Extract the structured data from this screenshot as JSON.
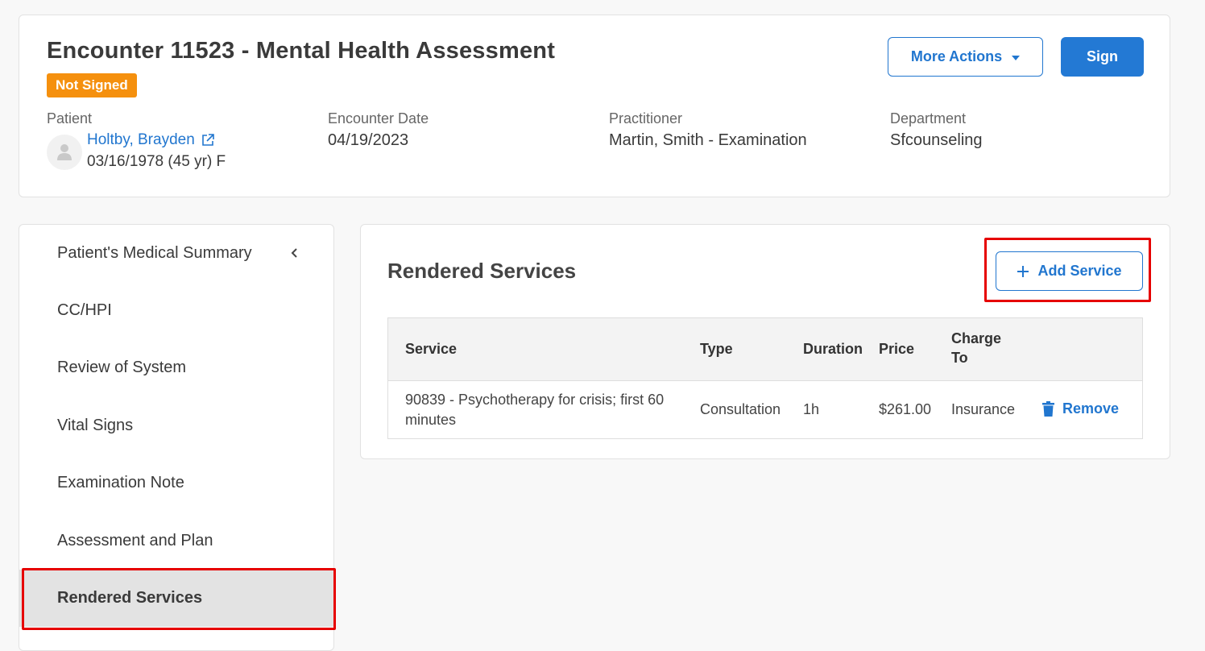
{
  "header": {
    "title": "Encounter 11523 - Mental Health Assessment",
    "status_badge": "Not Signed",
    "more_actions_label": "More Actions",
    "sign_label": "Sign",
    "patient_label": "Patient",
    "patient_name": "Holtby, Brayden",
    "patient_dob": "03/16/1978 (45 yr) F",
    "encounter_date_label": "Encounter Date",
    "encounter_date": "04/19/2023",
    "practitioner_label": "Practitioner",
    "practitioner": "Martin, Smith - Examination",
    "department_label": "Department",
    "department": "Sfcounseling"
  },
  "sidebar": {
    "items": [
      {
        "label": "Patient's Medical Summary"
      },
      {
        "label": "CC/HPI"
      },
      {
        "label": "Review of System"
      },
      {
        "label": "Vital Signs"
      },
      {
        "label": "Examination Note"
      },
      {
        "label": "Assessment and Plan"
      },
      {
        "label": "Rendered Services",
        "active": true
      }
    ]
  },
  "main": {
    "title": "Rendered Services",
    "add_service_label": "Add Service",
    "table": {
      "headers": {
        "service": "Service",
        "type": "Type",
        "duration": "Duration",
        "price": "Price",
        "charge_to_line1": "Charge",
        "charge_to_line2": "To"
      },
      "rows": [
        {
          "service_line1": "90839 - Psychotherapy for crisis; first 60",
          "service_line2": "minutes",
          "type": "Consultation",
          "duration": "1h",
          "price": "$261.00",
          "charge_to": "Insurance",
          "remove_label": "Remove"
        }
      ]
    }
  },
  "colors": {
    "accent": "#2176cf",
    "badge": "#f5900e",
    "highlight": "#e60000"
  }
}
